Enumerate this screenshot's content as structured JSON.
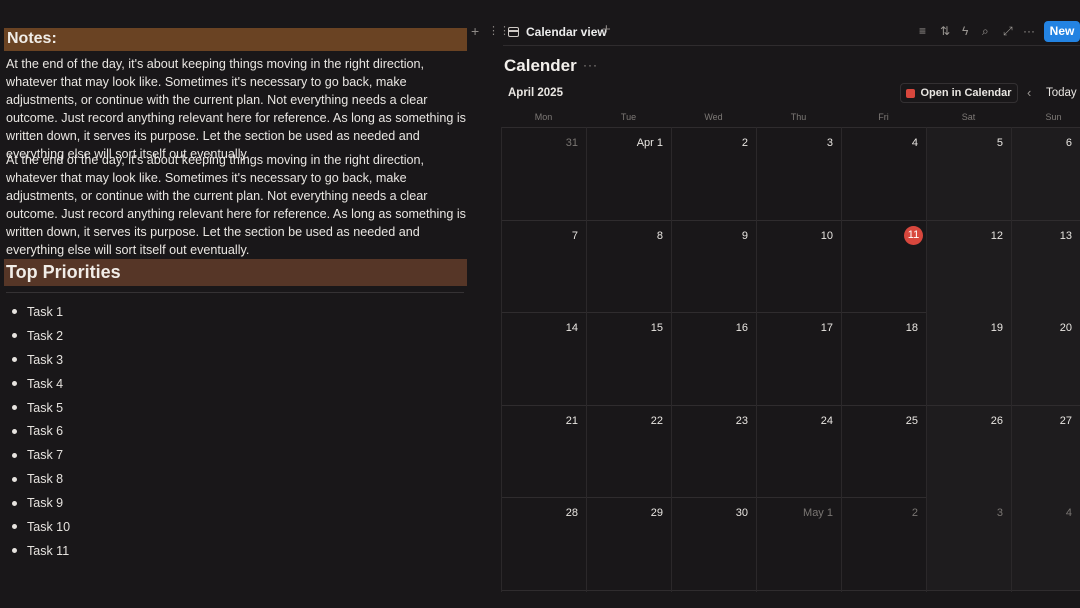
{
  "notes": {
    "heading": "Notes:",
    "paragraphs": [
      "At the end of the day, it's about keeping things moving in the right direction, whatever that may look like. Sometimes it's necessary to go back, make adjustments, or continue with the current plan. Not everything needs a clear outcome. Just record anything relevant here for reference. As long as something is written down, it serves its purpose. Let the section be used as needed and everything else will sort itself out eventually.",
      "At the end of the day, it's about keeping things moving in the right direction, whatever that may look like. Sometimes it's necessary to go back, make adjustments, or continue with the current plan. Not everything needs a clear outcome. Just record anything relevant here for reference. As long as something is written down, it serves its purpose. Let the section be used as needed and everything else will sort itself out eventually."
    ]
  },
  "priorities": {
    "heading": "Top Priorities",
    "tasks": [
      "Task 1",
      "Task 2",
      "Task 3",
      "Task 4",
      "Task 5",
      "Task 6",
      "Task 7",
      "Task 8",
      "Task 9",
      "Task 10",
      "Task 11"
    ]
  },
  "calendar": {
    "view_tab_label": "Calendar view",
    "new_button_label": "New",
    "title": "Calender",
    "month_label": "April 2025",
    "open_in_calendar_label": "Open in Calendar",
    "today_label": "Today",
    "weekdays": [
      "Mon",
      "Tue",
      "Wed",
      "Thu",
      "Fri",
      "Sat",
      "Sun"
    ],
    "weeks": [
      [
        "31",
        "Apr 1",
        "2",
        "3",
        "4",
        "5",
        "6"
      ],
      [
        "7",
        "8",
        "9",
        "10",
        "11",
        "12",
        "13"
      ],
      [
        "14",
        "15",
        "16",
        "17",
        "18",
        "19",
        "20"
      ],
      [
        "21",
        "22",
        "23",
        "24",
        "25",
        "26",
        "27"
      ],
      [
        "28",
        "29",
        "30",
        "May 1",
        "2",
        "3",
        "4"
      ]
    ],
    "muted_days": [
      "31",
      "May 1",
      "2",
      "3",
      "4"
    ],
    "today_date": "11",
    "colors": {
      "accent": "#2383e2",
      "today": "#d8473d",
      "notes_heading_bg": "#6a4323",
      "priorities_heading_bg": "#563627"
    }
  }
}
